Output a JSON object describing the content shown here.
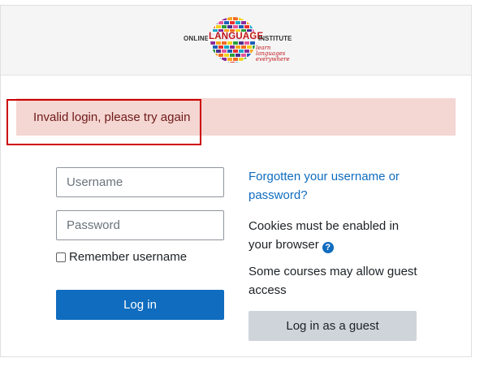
{
  "logo": {
    "text_left": "ONLINE",
    "text_main": "LANGUAGE",
    "text_right": "INSTITUTE",
    "tagline": "learn languages everywhere"
  },
  "alert": {
    "message": "Invalid login, please try again"
  },
  "form": {
    "username_placeholder": "Username",
    "password_placeholder": "Password",
    "remember_label": "Remember username",
    "login_button": "Log in"
  },
  "info": {
    "forgotten_link": "Forgotten your username or password?",
    "cookies_text": "Cookies must be enabled in your browser",
    "guest_text": "Some courses may allow guest access",
    "guest_button": "Log in as a guest"
  },
  "colors": {
    "primary": "#0f6cbf",
    "alert_bg": "#f4d6d2",
    "alert_text": "#6e1a19",
    "highlight": "#cc0000"
  }
}
